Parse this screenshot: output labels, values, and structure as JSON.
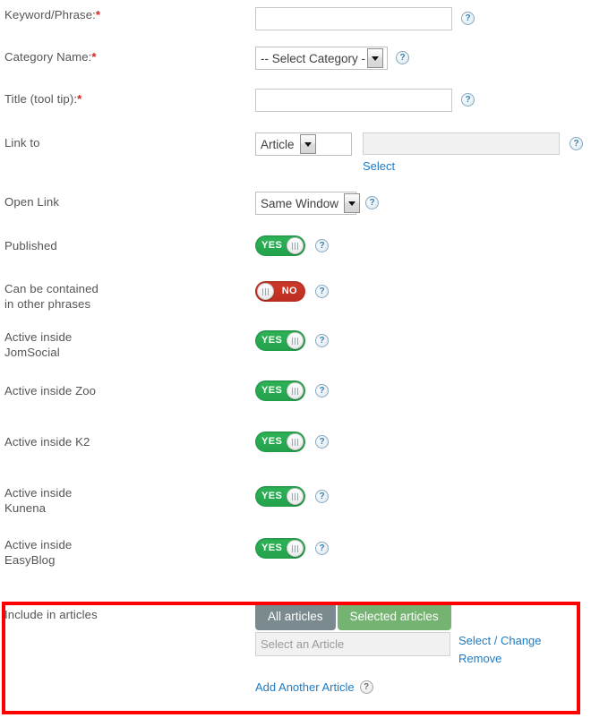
{
  "form": {
    "rows": [
      {
        "id": "keyword-phrase",
        "label": "Keyword/Phrase:",
        "required": true,
        "control": "text",
        "value": "",
        "placeholder": "",
        "help": "?"
      },
      {
        "id": "category-name",
        "label": "Category Name:",
        "required": true,
        "control": "select",
        "value": "-- Select Category - -",
        "help": "?"
      },
      {
        "id": "title-tooltip",
        "label": "Title (tool tip):",
        "required": true,
        "control": "text",
        "value": "",
        "placeholder": "",
        "help": "?"
      },
      {
        "id": "link-to",
        "label": "Link to",
        "required": false,
        "control": "link",
        "value": "Article",
        "target_value": "",
        "target_placeholder": "",
        "select_link": "Select",
        "help": "?"
      },
      {
        "id": "open-link",
        "label": "Open Link",
        "required": false,
        "control": "select",
        "value": "Same Window",
        "help": "?"
      },
      {
        "id": "published",
        "label": "Published",
        "required": false,
        "control": "toggle",
        "state": "YES",
        "help": "?"
      },
      {
        "id": "can-be-contained",
        "label": "Can be contained\nin other phrases",
        "label_line1": "Can be contained",
        "label_line2": "in other phrases",
        "required": false,
        "control": "toggle",
        "state": "NO",
        "help": "?"
      },
      {
        "id": "active-inside-jomsocial",
        "label_line1": "Active inside",
        "label_line2": "JomSocial",
        "required": false,
        "control": "toggle",
        "state": "YES",
        "help": "?"
      },
      {
        "id": "active-inside-zoo",
        "label_line1": "Active inside Zoo",
        "label_line2": "",
        "required": false,
        "control": "toggle",
        "state": "YES",
        "help": "?"
      },
      {
        "id": "active-inside-k2",
        "label_line1": "Active inside K2",
        "label_line2": "",
        "required": false,
        "control": "toggle",
        "state": "YES",
        "help": "?"
      },
      {
        "id": "active-inside-kunena",
        "label_line1": "Active inside",
        "label_line2": "Kunena",
        "required": false,
        "control": "toggle",
        "state": "YES",
        "help": "?"
      },
      {
        "id": "active-inside-easyblog",
        "label_line1": "Active inside",
        "label_line2": "EasyBlog",
        "required": false,
        "control": "toggle",
        "state": "YES",
        "help": "?"
      }
    ],
    "include_in_articles": {
      "label": "Include in articles",
      "buttons": {
        "all_articles": "All articles",
        "selected_articles": "Selected articles",
        "active": "Selected articles"
      },
      "article_input_placeholder": "Select an Article",
      "article_input_value": "",
      "links": {
        "select_change": "Select / Change",
        "remove": "Remove",
        "add_another": "Add Another Article"
      },
      "help": "?"
    }
  },
  "colors": {
    "toggle_on": "#27a84c",
    "toggle_off": "#c4301f",
    "link": "#1e7bc4",
    "required_asterisk": "#d02525",
    "highlight_border": "#ff0000",
    "button_gray": "#7b8a8e",
    "button_green": "#74b371",
    "label_text": "#555555"
  }
}
